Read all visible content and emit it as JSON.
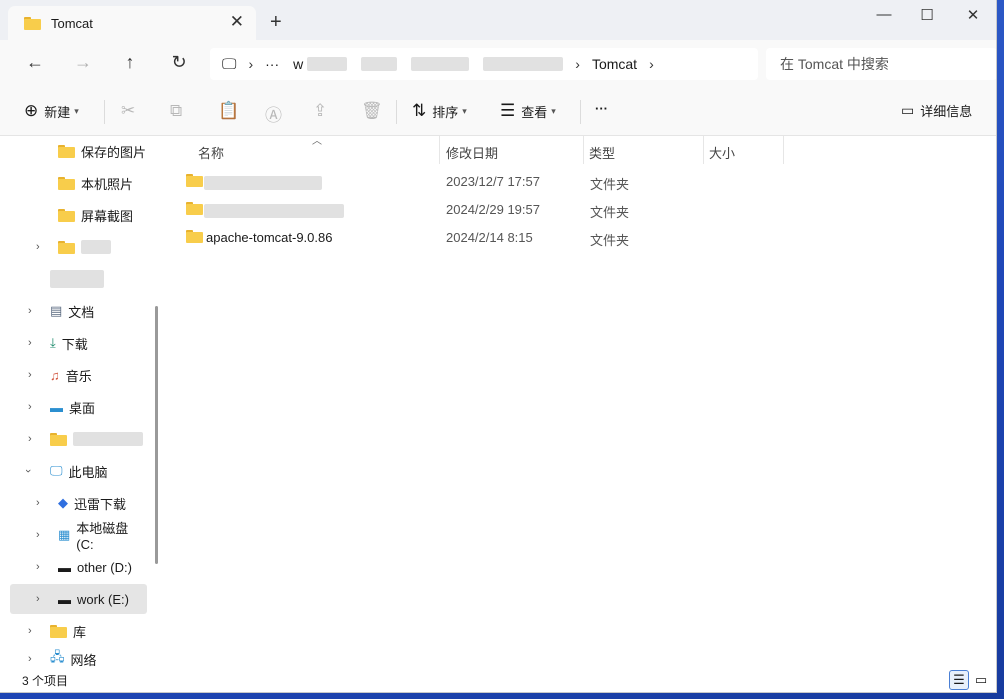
{
  "window": {
    "tab_title": "Tomcat",
    "new_tab_glyph": "+",
    "close_tab_glyph": "✕",
    "minimize_glyph": "—",
    "maximize_glyph": "☐",
    "close_glyph": "✕"
  },
  "navigation": {
    "back_glyph": "←",
    "forward_glyph": "→",
    "up_glyph": "↑",
    "refresh_glyph": "↻",
    "pc_glyph": "🖵",
    "more_glyph": "···",
    "breadcrumb_first": "w",
    "breadcrumb_current": "Tomcat",
    "sep_glyph": "›",
    "search_placeholder": "在 Tomcat 中搜索"
  },
  "toolbar": {
    "new_label": "新建",
    "sort_label": "排序",
    "view_label": "查看",
    "more_label": "···",
    "details_label": "详细信息"
  },
  "sidebar": {
    "items": [
      {
        "label": "保存的图片"
      },
      {
        "label": "本机照片"
      },
      {
        "label": "屏幕截图"
      },
      {
        "label": ""
      },
      {
        "label": "文档"
      },
      {
        "label": "下载"
      },
      {
        "label": "音乐"
      },
      {
        "label": "桌面"
      },
      {
        "label": ""
      },
      {
        "label": "此电脑"
      },
      {
        "label": "迅雷下载"
      },
      {
        "label": "本地磁盘 (C:"
      },
      {
        "label": "other (D:)"
      },
      {
        "label": "work (E:)"
      },
      {
        "label": "库"
      },
      {
        "label": "网络"
      }
    ]
  },
  "columns": {
    "name": "名称",
    "date": "修改日期",
    "type": "类型",
    "size": "大小"
  },
  "files": [
    {
      "name": "",
      "date": "2023/12/7 17:57",
      "type": "文件夹"
    },
    {
      "name": "",
      "date": "2024/2/29 19:57",
      "type": "文件夹"
    },
    {
      "name": "apache-tomcat-9.0.86",
      "date": "2024/2/14 8:15",
      "type": "文件夹"
    }
  ],
  "status": {
    "item_count": "3 个项目"
  },
  "colors": {
    "folder": "#f8cd4b",
    "selected_bg": "#e5e5e5",
    "chrome_bg": "#f9f9f9"
  }
}
